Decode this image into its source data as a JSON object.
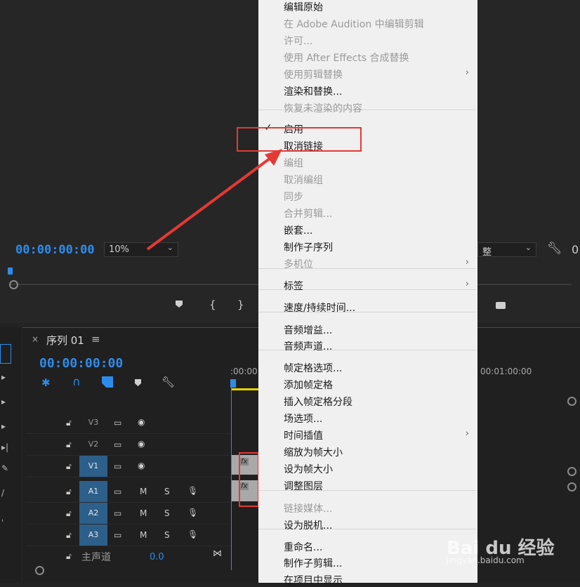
{
  "program_monitor": {
    "timecode": "00:00:00:00",
    "zoom": "10%",
    "fit_label": "整",
    "right_partial": "0"
  },
  "sequence": {
    "close": "×",
    "name": "序列 01",
    "timecode": "00:00:00:00",
    "ruler_start": ":00:00",
    "ruler_end": "00:01:00:00"
  },
  "tracks": {
    "video": [
      {
        "label": "V3",
        "active": false
      },
      {
        "label": "V2",
        "active": false
      },
      {
        "label": "V1",
        "active": true
      }
    ],
    "audio": [
      {
        "label": "A1",
        "m": "M",
        "s": "S"
      },
      {
        "label": "A2",
        "m": "M",
        "s": "S"
      },
      {
        "label": "A3",
        "m": "M",
        "s": "S"
      }
    ],
    "master": {
      "label": "主声道",
      "value": "0.0"
    }
  },
  "menu": {
    "items": [
      {
        "label": "编辑原始",
        "disabled": false
      },
      {
        "label": "在 Adobe Audition 中编辑剪辑",
        "disabled": true
      },
      {
        "label": "许可...",
        "disabled": true
      },
      {
        "label": "使用 After Effects 合成替换",
        "disabled": true
      },
      {
        "label": "使用剪辑替换",
        "disabled": true,
        "submenu": true
      },
      {
        "label": "渲染和替换...",
        "disabled": false
      },
      {
        "label": "恢复未渲染的内容",
        "disabled": true
      },
      {
        "label": "启用",
        "disabled": false,
        "checked": true
      },
      {
        "label": "取消链接",
        "disabled": false
      },
      {
        "label": "编组",
        "disabled": true
      },
      {
        "label": "取消编组",
        "disabled": true
      },
      {
        "label": "同步",
        "disabled": true
      },
      {
        "label": "合并剪辑...",
        "disabled": true
      },
      {
        "label": "嵌套...",
        "disabled": false
      },
      {
        "label": "制作子序列",
        "disabled": false
      },
      {
        "label": "多机位",
        "disabled": true,
        "submenu": true
      },
      {
        "label": "标签",
        "disabled": false,
        "submenu": true
      },
      {
        "label": "速度/持续时间...",
        "disabled": false
      },
      {
        "label": "音频增益...",
        "disabled": false
      },
      {
        "label": "音频声道...",
        "disabled": false
      },
      {
        "label": "帧定格选项...",
        "disabled": false
      },
      {
        "label": "添加帧定格",
        "disabled": false
      },
      {
        "label": "插入帧定格分段",
        "disabled": false
      },
      {
        "label": "场选项...",
        "disabled": false
      },
      {
        "label": "时间插值",
        "disabled": false,
        "submenu": true
      },
      {
        "label": "缩放为帧大小",
        "disabled": false
      },
      {
        "label": "设为帧大小",
        "disabled": false
      },
      {
        "label": "调整图层",
        "disabled": false
      },
      {
        "label": "链接媒体...",
        "disabled": true
      },
      {
        "label": "设为脱机...",
        "disabled": false
      },
      {
        "label": "重命名...",
        "disabled": false
      },
      {
        "label": "制作子剪辑...",
        "disabled": false
      },
      {
        "label": "在项目中显示",
        "disabled": false
      }
    ],
    "submenu_arrow": "›",
    "check_mark": "✓"
  },
  "watermark": {
    "brand": "Bai du 经验",
    "url": "jingyan.baidu.com"
  },
  "colors": {
    "accent": "#2d8ceb",
    "highlight": "#e53935",
    "menu_bg": "#f0f0f0"
  }
}
